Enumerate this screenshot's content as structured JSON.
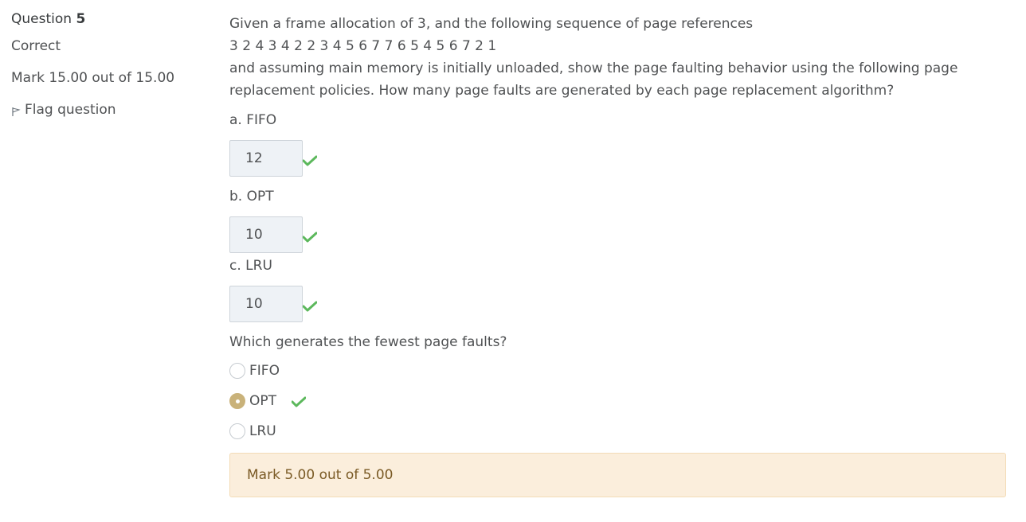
{
  "info": {
    "question_prefix": "Question",
    "question_number": "5",
    "state": "Correct",
    "grade": "Mark 15.00 out of 15.00",
    "flag_label": "Flag question"
  },
  "question": {
    "line1": "Given a frame allocation of 3, and the following sequence of page references",
    "line2": "3 2 4 3 4 2 2 3 4 5 6 7 7 6 5 4 5 6 7 2 1",
    "line3": "and assuming main memory is initially unloaded, show the page faulting behavior using the following page",
    "line4": "replacement policies. How many page faults are generated by each page replacement algorithm?"
  },
  "parts": [
    {
      "label": "a. FIFO",
      "answer": "12"
    },
    {
      "label": "b. OPT",
      "answer": "10"
    },
    {
      "label": "c. LRU",
      "answer": "10"
    }
  ],
  "mc": {
    "prompt": "Which generates the fewest page faults?",
    "options": [
      "FIFO",
      "OPT",
      "LRU"
    ],
    "selected": "OPT"
  },
  "outcome": "Mark 5.00 out of 5.00",
  "colors": {
    "check": "#5cb85c",
    "radio_selected": "#c9b27a",
    "outcome_bg": "#fbeedc"
  }
}
